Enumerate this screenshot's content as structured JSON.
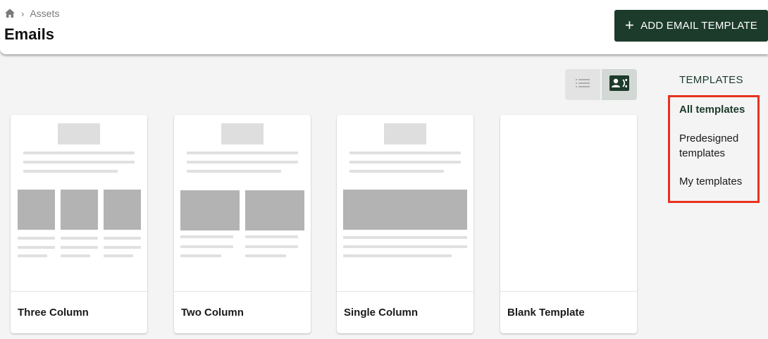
{
  "header": {
    "breadcrumb": {
      "home_icon": "home-icon",
      "separator": "›",
      "item": "Assets"
    },
    "title": "Emails",
    "add_button": {
      "icon": "plus-icon",
      "label": "ADD EMAIL TEMPLATE"
    }
  },
  "view_toggle": {
    "list_icon": "list-icon",
    "card_icon": "contact-card-icon",
    "selected": "card"
  },
  "templates": [
    {
      "name": "Three Column"
    },
    {
      "name": "Two Column"
    },
    {
      "name": "Single Column"
    },
    {
      "name": "Blank Template"
    }
  ],
  "sidebar": {
    "heading": "TEMPLATES",
    "items": [
      {
        "label": "All templates",
        "active": true
      },
      {
        "label": "Predesigned templates",
        "active": false
      },
      {
        "label": "My templates",
        "active": false
      }
    ]
  },
  "colors": {
    "accent": "#1d3b2b",
    "highlight_border": "#e8321f",
    "background": "#f4f4f4"
  }
}
